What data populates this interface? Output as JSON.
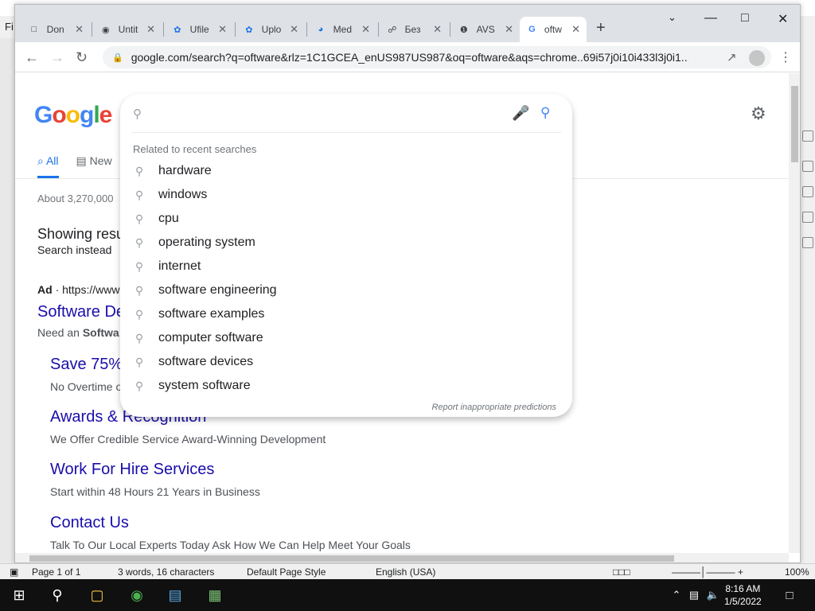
{
  "writer": {
    "menu_first": "Fi",
    "status": {
      "page": "Page 1 of 1",
      "words": "3 words, 16 characters",
      "style": "Default Page Style",
      "language": "English (USA)",
      "zoom": "100%"
    }
  },
  "browser": {
    "tabs": [
      {
        "title": "Don",
        "favicon": "doc-icon"
      },
      {
        "title": "Untit",
        "favicon": "globe-icon"
      },
      {
        "title": "Ufile",
        "favicon": "ufile-icon"
      },
      {
        "title": "Uplo",
        "favicon": "ufile-icon"
      },
      {
        "title": "Med",
        "favicon": "media-icon"
      },
      {
        "title": "Без",
        "favicon": "app-icon"
      },
      {
        "title": "AVS",
        "favicon": "avs-icon"
      },
      {
        "title": "oftw",
        "favicon": "google-icon",
        "active": true
      }
    ],
    "url": "google.com/search?q=oftware&rlz=1C1GCEA_enUS987US987&oq=oftware&aqs=chrome..69i57j0i10i433l3j0i1..."
  },
  "page": {
    "logo": "Google",
    "tabs": [
      "All",
      "New"
    ],
    "stats": "About 3,270,000",
    "showing": "Showing resu",
    "search_instead": "Search instead",
    "ad_label": "Ad",
    "ad_url": "· https://www.",
    "ad_title": "Software De",
    "ad_desc_prefix": "Need an",
    "ad_desc_bold": "Softwa",
    "sitelinks": [
      {
        "title": "Save 75%",
        "desc": "No Overtime o"
      },
      {
        "title": "Awards & Recognition",
        "desc": "We Offer Credible Service Award-Winning Development"
      },
      {
        "title": "Work For Hire Services",
        "desc": "Start within 48 Hours 21 Years in Business"
      },
      {
        "title": "Contact Us",
        "desc": "Talk To Our Local Experts Today Ask How We Can Help Meet Your Goals"
      }
    ]
  },
  "dropdown": {
    "input_value": "",
    "related_label": "Related to recent searches",
    "suggestions": [
      "hardware",
      "windows",
      "cpu",
      "operating system",
      "internet",
      "software engineering",
      "software examples",
      "computer software",
      "software devices",
      "system software"
    ],
    "report": "Report inappropriate predictions"
  },
  "taskbar": {
    "time": "8:16 AM",
    "date": "1/5/2022"
  },
  "colors": {
    "link": "#1a0dab",
    "google_blue": "#4285f4"
  }
}
